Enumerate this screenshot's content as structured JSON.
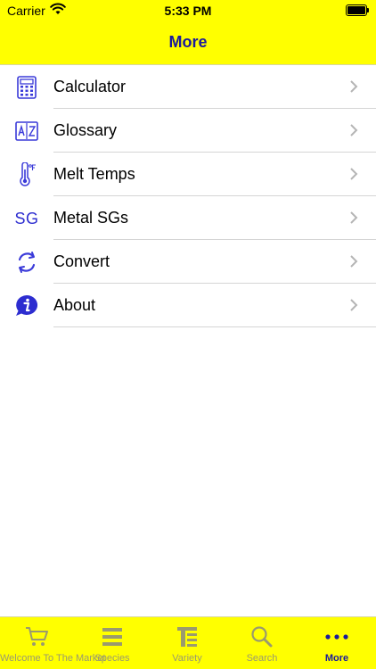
{
  "status_bar": {
    "carrier": "Carrier",
    "time": "5:33 PM"
  },
  "nav": {
    "title": "More"
  },
  "colors": {
    "bar": "#ffff00",
    "title": "#1a1a9c",
    "icon": "#3a3ad9",
    "inactive_tab": "#9a9a6e"
  },
  "menu": {
    "items": [
      {
        "label": "Calculator",
        "icon": "calculator-icon"
      },
      {
        "label": "Glossary",
        "icon": "glossary-az-icon"
      },
      {
        "label": "Melt Temps",
        "icon": "thermometer-icon"
      },
      {
        "label": "Metal SGs",
        "icon": "sg-text-icon",
        "icon_text": "SG"
      },
      {
        "label": "Convert",
        "icon": "convert-arrows-icon"
      },
      {
        "label": "About",
        "icon": "info-bubble-icon"
      }
    ]
  },
  "tabbar": {
    "tabs": [
      {
        "label": "Welcome To The Market",
        "icon": "cart-icon",
        "active": false
      },
      {
        "label": "Species",
        "icon": "list-icon",
        "active": false
      },
      {
        "label": "Variety",
        "icon": "variety-icon",
        "active": false
      },
      {
        "label": "Search",
        "icon": "search-icon",
        "active": false
      },
      {
        "label": "More",
        "icon": "more-dots-icon",
        "active": true
      }
    ]
  }
}
